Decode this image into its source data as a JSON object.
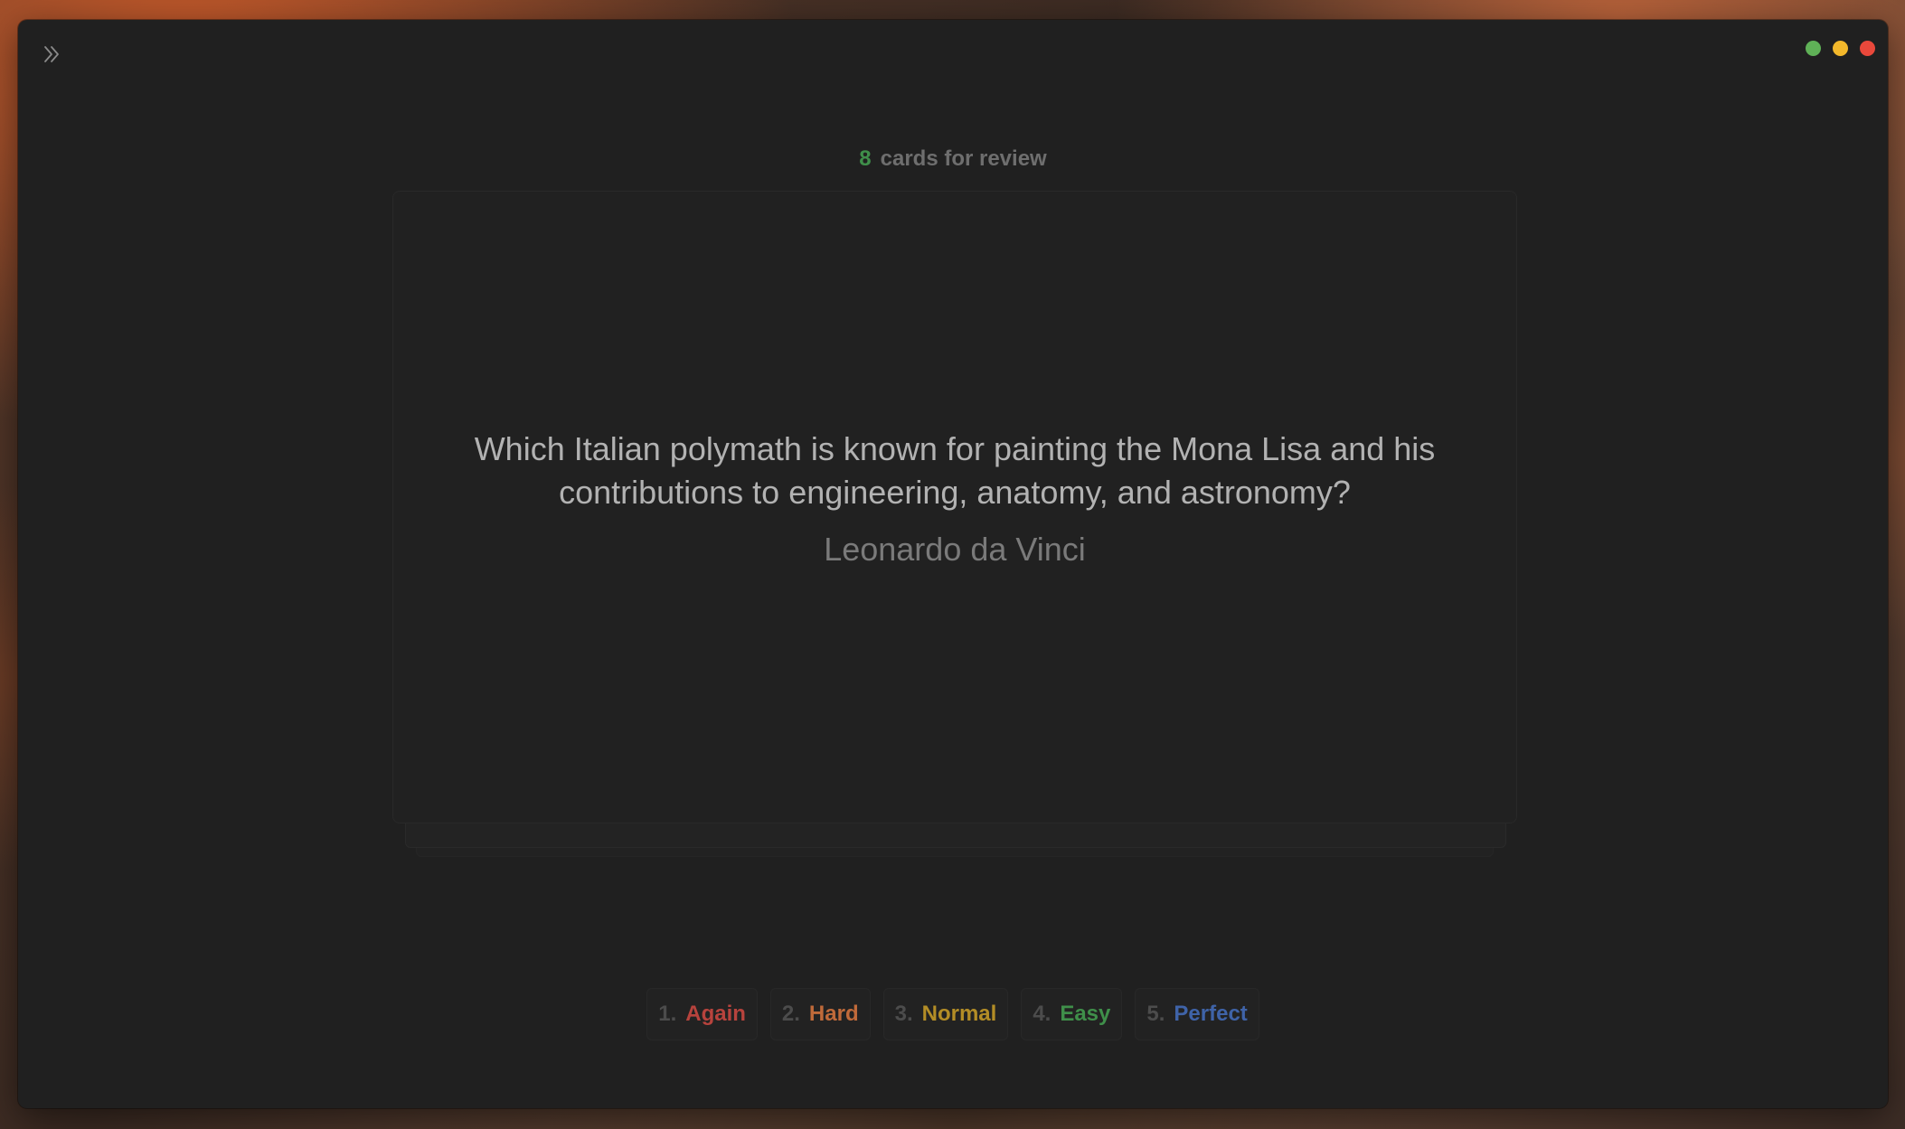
{
  "window": {
    "traffic_lights": [
      {
        "name": "green",
        "color": "#5fb157"
      },
      {
        "name": "yellow",
        "color": "#f3b82b"
      },
      {
        "name": "red",
        "color": "#e9483b"
      }
    ]
  },
  "header": {
    "count": "8",
    "label": "cards for review"
  },
  "card": {
    "question": "Which Italian polymath is known for painting the Mona Lisa and his contributions to engineering, anatomy, and astronomy?",
    "answer": "Leonardo da Vinci"
  },
  "ratings": [
    {
      "num": "1.",
      "label": "Again",
      "color": "#b8433d"
    },
    {
      "num": "2.",
      "label": "Hard",
      "color": "#c06a3a"
    },
    {
      "num": "3.",
      "label": "Normal",
      "color": "#b38d26"
    },
    {
      "num": "4.",
      "label": "Easy",
      "color": "#3f8f4a"
    },
    {
      "num": "5.",
      "label": "Perfect",
      "color": "#3f63a8"
    }
  ],
  "icons": {
    "sidebar_toggle": "double-chevron-right-icon"
  }
}
